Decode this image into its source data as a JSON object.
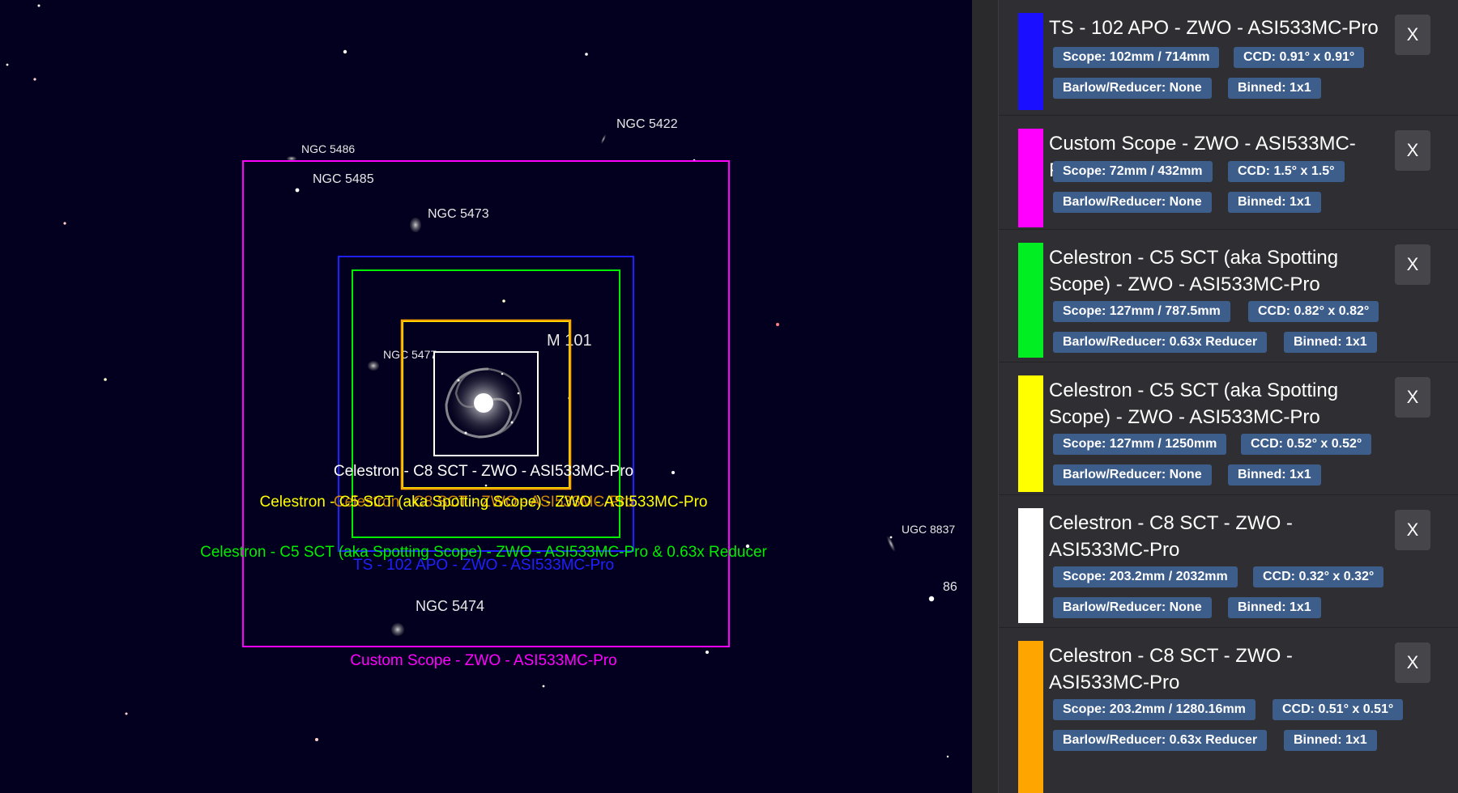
{
  "sky": {
    "objects": [
      {
        "label": "NGC 5422",
        "color": "#e6e6e6"
      },
      {
        "label": "NGC 5486",
        "color": "#e6e6e6"
      },
      {
        "label": "NGC 5485",
        "color": "#e6e6e6"
      },
      {
        "label": "NGC 5473",
        "color": "#e6e6e6"
      },
      {
        "label": "M 101",
        "color": "#e6e6e6"
      },
      {
        "label": "NGC 5477",
        "color": "#e6e6e6"
      },
      {
        "label": "UGC 8837",
        "color": "#e6e6e6"
      },
      {
        "label": "86",
        "color": "#e6e6e6"
      },
      {
        "label": "NGC 5474",
        "color": "#e6e6e6"
      }
    ],
    "fov_labels": {
      "white": "Celestron - C8 SCT - ZWO - ASI533MC-Pro",
      "orange": "Celestron - C8 SCT - ZWO - ASI533MC-Pro",
      "yellow": "Celestron - C5 SCT (aka Spotting Scope) - ZWO - ASI533MC-Pro",
      "green": "Celestron - C5 SCT (aka Spotting Scope) - ZWO - ASI533MC-Pro  & 0.63x Reducer",
      "blue": "TS - 102 APO - ZWO - ASI533MC-Pro",
      "magenta": "Custom Scope - ZWO - ASI533MC-Pro"
    },
    "fov_colors": {
      "white": "#ffffff",
      "orange": "#ffa500",
      "yellow": "#ffff00",
      "green": "#00ee00",
      "blue": "#2020ff",
      "magenta": "#ff00ff"
    }
  },
  "panel": {
    "close_label": "X",
    "cards": [
      {
        "title": "TS - 102 APO - ZWO - ASI533MC-Pro",
        "color": "#1a10ff",
        "scope": "Scope: 102mm / 714mm",
        "ccd": "CCD: 0.91° x 0.91°",
        "barlow": "Barlow/Reducer: None",
        "binned": "Binned: 1x1"
      },
      {
        "title": "Custom Scope - ZWO - ASI533MC-Pro",
        "color": "#ff00ff",
        "scope": "Scope: 72mm / 432mm",
        "ccd": "CCD: 1.5° x 1.5°",
        "barlow": "Barlow/Reducer: None",
        "binned": "Binned: 1x1"
      },
      {
        "title": "Celestron - C5 SCT (aka Spotting Scope) - ZWO - ASI533MC-Pro",
        "color": "#00ee22",
        "scope": "Scope: 127mm / 787.5mm",
        "ccd": "CCD: 0.82° x 0.82°",
        "barlow": "Barlow/Reducer: 0.63x Reducer",
        "binned": "Binned: 1x1"
      },
      {
        "title": "Celestron - C5 SCT (aka Spotting Scope) - ZWO - ASI533MC-Pro",
        "color": "#ffff00",
        "scope": "Scope: 127mm / 1250mm",
        "ccd": "CCD: 0.52° x 0.52°",
        "barlow": "Barlow/Reducer: None",
        "binned": "Binned: 1x1"
      },
      {
        "title": "Celestron - C8 SCT - ZWO - ASI533MC-Pro",
        "color": "#ffffff",
        "scope": "Scope: 203.2mm / 2032mm",
        "ccd": "CCD: 0.32° x 0.32°",
        "barlow": "Barlow/Reducer: None",
        "binned": "Binned: 1x1"
      },
      {
        "title": "Celestron - C8 SCT - ZWO - ASI533MC-Pro",
        "color": "#ffa500",
        "scope": "Scope: 203.2mm / 1280.16mm",
        "ccd": "CCD: 0.51° x 0.51°",
        "barlow": "Barlow/Reducer: 0.63x Reducer",
        "binned": "Binned: 1x1"
      }
    ]
  }
}
